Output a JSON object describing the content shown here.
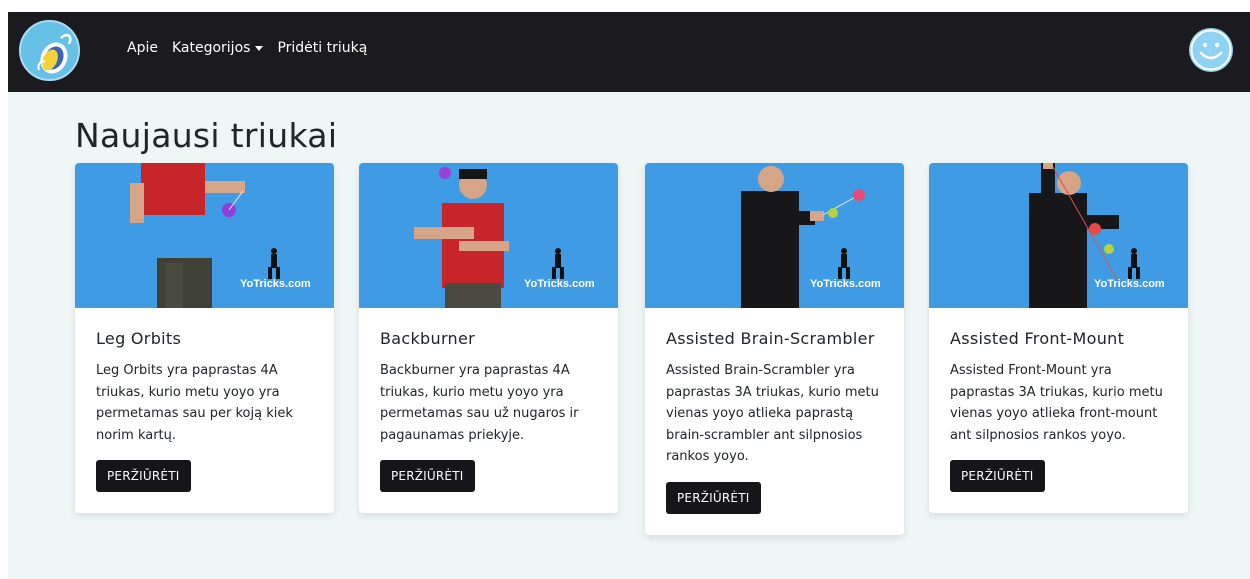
{
  "nav": {
    "links": [
      "Apie",
      "Kategorijos",
      "Pridėti triuką"
    ]
  },
  "page": {
    "title": "Naujausi triukai"
  },
  "cards": [
    {
      "title": "Leg Orbits",
      "text": "Leg Orbits yra paprastas 4A triukas, kurio metu yoyo yra permetamas sau per koją kiek norim kartų.",
      "button": "PERŽIŪRĖTI",
      "watermark": "YoTricks.com",
      "shirt_color": "#c8252a"
    },
    {
      "title": "Backburner",
      "text": "Backburner yra paprastas 4A triukas, kurio metu yoyo yra permetamas sau už nugaros ir pagaunamas priekyje.",
      "button": "PERŽIŪRĖTI",
      "watermark": "YoTricks.com",
      "shirt_color": "#c8252a"
    },
    {
      "title": "Assisted Brain-Scrambler",
      "text": "Assisted Brain-Scrambler yra paprastas 3A triukas, kurio metu vienas yoyo atlieka paprastą brain-scrambler ant silpnosios rankos yoyo.",
      "button": "PERŽIŪRĖTI",
      "watermark": "YoTricks.com",
      "shirt_color": "#17171a"
    },
    {
      "title": "Assisted Front-Mount",
      "text": "Assisted Front-Mount yra paprastas 3A triukas, kurio metu vienas yoyo atlieka front-mount ant silpnosios rankos yoyo.",
      "button": "PERŽIŪRĖTI",
      "watermark": "YoTricks.com",
      "shirt_color": "#17171a"
    }
  ],
  "colors": {
    "navbar": "#1b1b1f",
    "page_bg": "#eef6f6",
    "photo_bg": "#3f9be3",
    "logo_bg": "#67c1e6",
    "avatar": "#8fd3f4"
  }
}
